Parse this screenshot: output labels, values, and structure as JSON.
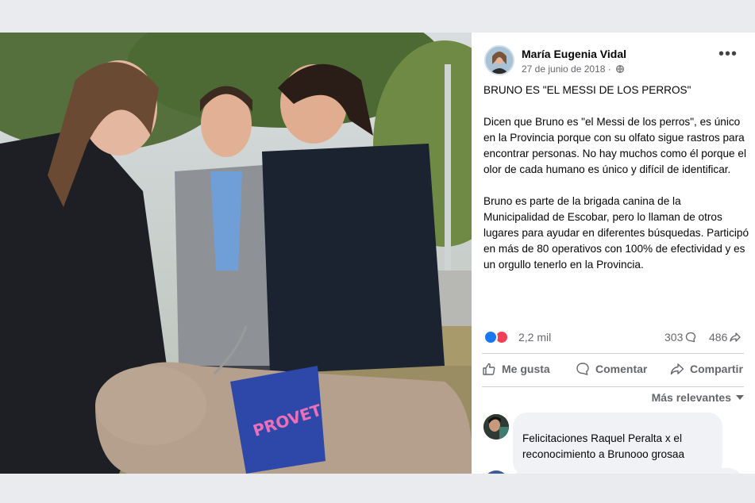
{
  "post": {
    "author": "María Eugenia Vidal",
    "date": "27 de junio de 2018",
    "more_label": "•••",
    "title": "BRUNO ES \"EL MESSI DE LOS PERROS\"",
    "paragraph1": "Dicen que Bruno es \"el Messi de los perros\", es único en la Provincia porque con su olfato sigue rastros para encontrar personas. No hay muchos como él porque el olor de cada humano es único y difícil de identificar.",
    "paragraph2": "Bruno es parte de la brigada canina de la Municipalidad de Escobar, pero lo llaman de otros lugares para ayudar en diferentes búsquedas. Participó en más de 80 operativos con 100% de efectividad y es un orgullo tenerlo en la Provincia."
  },
  "photo": {
    "harness_text": "PROVET"
  },
  "stats": {
    "reactions": "2,2 mil",
    "comments": "303",
    "shares": "486"
  },
  "actions": {
    "like": "Me gusta",
    "comment": "Comentar",
    "share": "Compartir"
  },
  "comments": {
    "sort_label": "Más relevantes",
    "first_text": "Felicitaciones Raquel Peralta x el reconocimiento a Brunooo grosaa"
  },
  "colors": {
    "like_blue": "#1877f2",
    "love_red": "#f33e58",
    "muted_text": "#65676b"
  }
}
